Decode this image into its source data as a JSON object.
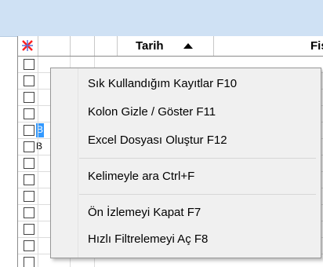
{
  "grid": {
    "columns": {
      "tarih": "Tarih",
      "fis": "Fiş N"
    },
    "row_marker": "B"
  },
  "menu": {
    "items": [
      {
        "label": "Sık Kullandığım Kayıtlar  F10"
      },
      {
        "label": "Kolon Gizle / Göster  F11"
      },
      {
        "label": "Excel Dosyası Oluştur F12"
      },
      {
        "label": "Kelimeyle ara  Ctrl+F"
      },
      {
        "label": "Ön İzlemeyi Kapat F7"
      },
      {
        "label": "Hızlı Filtrelemeyi Aç F8"
      }
    ]
  }
}
